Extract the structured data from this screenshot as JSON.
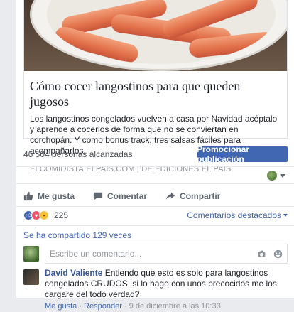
{
  "post": {
    "link_preview": {
      "title": "Cómo cocer langostinos para que queden jugosos",
      "description": "Los langostinos congelados vuelven a casa por Navidad acéptalo y aprende a cocerlos de forma que no se conviertan en corchopán. Y como bonus track, tres salsas fáciles para acompañarlos.",
      "source": "ELCOMIDISTA.ELPAIS.COM | DE EDICIONES EL PAIS"
    },
    "reach_text": "46 504 personas alcanzadas",
    "promote_label": "Promocionar publicación"
  },
  "actions": {
    "like": "Me gusta",
    "comment": "Comentar",
    "share": "Compartir"
  },
  "reactions": {
    "count": "225",
    "featured_comments_label": "Comentarios destacados"
  },
  "shares_text": "Se ha compartido 129 veces",
  "composer": {
    "placeholder": "Escribe un comentario..."
  },
  "comment": {
    "author": "David Valiente",
    "text": "Entiendo que esto es solo para langostinos congelados CRUDOS. si lo hago con unos precocidos me los cargare del todo verdad?",
    "like_label": "Me gusta",
    "reply_label": "Responder",
    "timestamp": "9 de diciembre a las 10:33"
  },
  "colors": {
    "accent": "#4267b2",
    "link": "#365899",
    "muted": "#90949c"
  }
}
